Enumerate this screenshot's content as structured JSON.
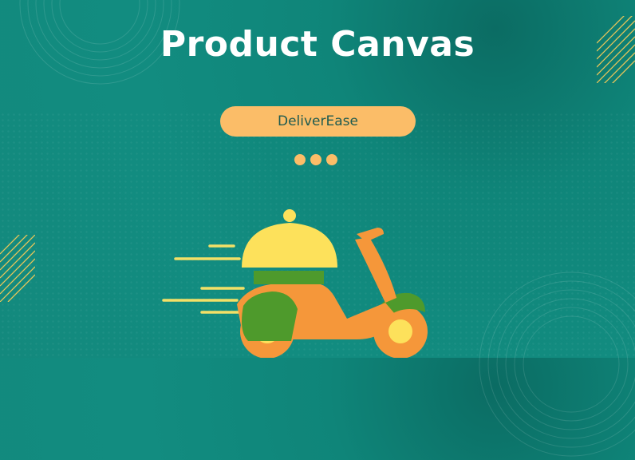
{
  "slide": {
    "title": "Product Canvas",
    "product_name": "DeliverEase"
  },
  "colors": {
    "background": "#128c80",
    "pill": "#fbbd68",
    "title_text": "#ffffff",
    "scooter_body": "#f5973a",
    "scooter_green": "#4e9a2c",
    "cloche": "#fde15b",
    "speed_lines": "#f3e067"
  },
  "icons": {
    "illustration": "delivery-scooter-icon",
    "ellipsis": "more-dots-icon"
  }
}
